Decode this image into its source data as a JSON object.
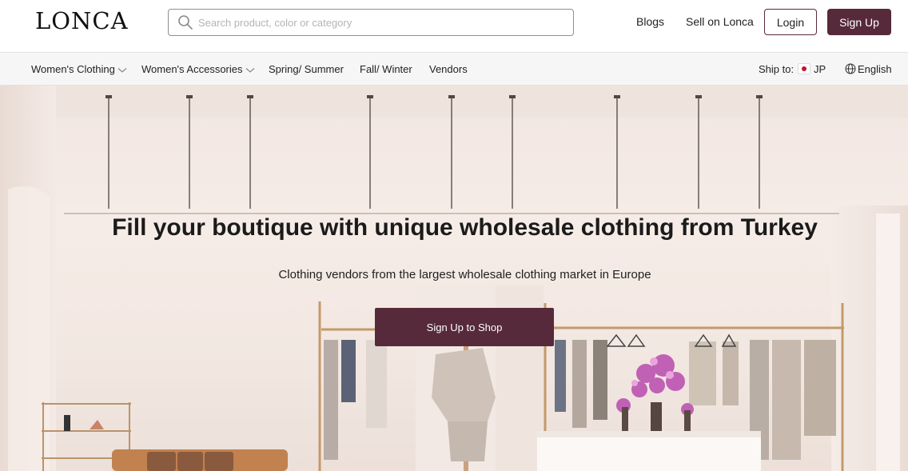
{
  "header": {
    "logo": "LONCA",
    "search_placeholder": "Search product, color or category",
    "links": {
      "blogs": "Blogs",
      "sell": "Sell on Lonca"
    },
    "login_label": "Login",
    "signup_label": "Sign Up"
  },
  "nav": {
    "items": [
      {
        "label": "Women's Clothing",
        "dropdown": true
      },
      {
        "label": "Women's Accessories",
        "dropdown": true
      },
      {
        "label": "Spring/ Summer",
        "dropdown": false
      },
      {
        "label": "Fall/ Winter",
        "dropdown": false
      },
      {
        "label": "Vendors",
        "dropdown": false
      }
    ],
    "ship_label": "Ship to:",
    "ship_country": "JP",
    "language": "English"
  },
  "hero": {
    "title": "Fill your boutique with unique wholesale clothing from Turkey",
    "subtitle": "Clothing vendors from the largest wholesale clothing market in Europe",
    "cta_label": "Sign Up to Shop"
  },
  "colors": {
    "brand": "#56293b",
    "nav_bg": "#f6f6f6",
    "hero_bg": "#f3e8e2"
  },
  "icons": [
    "search-icon",
    "chevron-down-icon",
    "japan-flag-icon",
    "globe-icon"
  ]
}
